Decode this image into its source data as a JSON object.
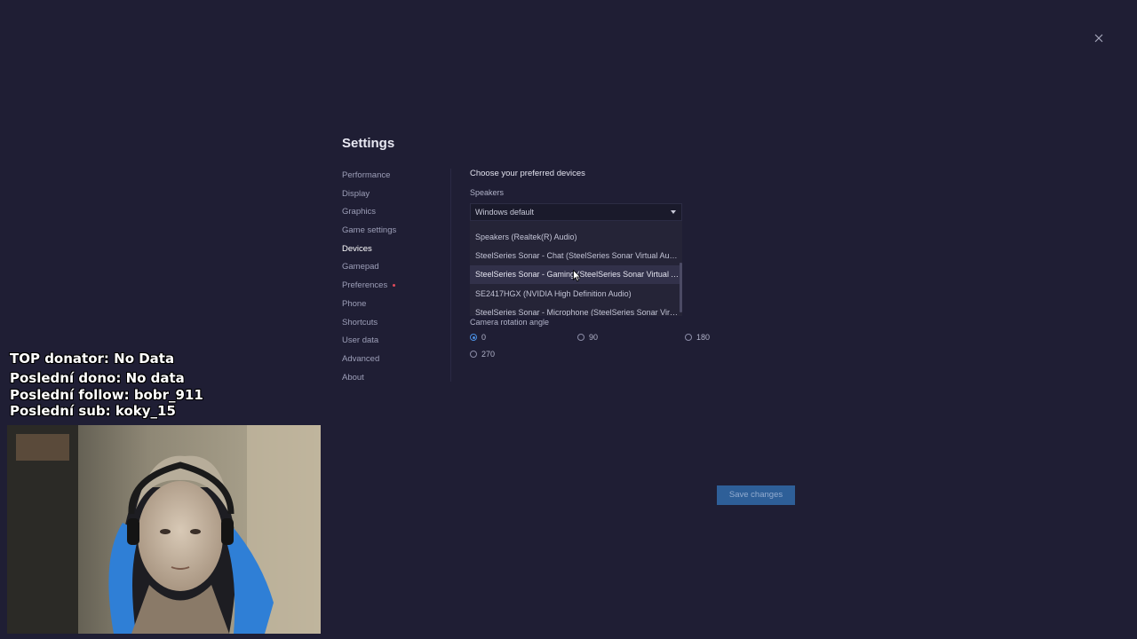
{
  "settings": {
    "title": "Settings",
    "nav": [
      {
        "label": "Performance",
        "name": "nav-performance",
        "active": false,
        "badge": false
      },
      {
        "label": "Display",
        "name": "nav-display",
        "active": false,
        "badge": false
      },
      {
        "label": "Graphics",
        "name": "nav-graphics",
        "active": false,
        "badge": false
      },
      {
        "label": "Game settings",
        "name": "nav-game-settings",
        "active": false,
        "badge": false
      },
      {
        "label": "Devices",
        "name": "nav-devices",
        "active": true,
        "badge": false
      },
      {
        "label": "Gamepad",
        "name": "nav-gamepad",
        "active": false,
        "badge": false
      },
      {
        "label": "Preferences",
        "name": "nav-preferences",
        "active": false,
        "badge": true
      },
      {
        "label": "Phone",
        "name": "nav-phone",
        "active": false,
        "badge": false
      },
      {
        "label": "Shortcuts",
        "name": "nav-shortcuts",
        "active": false,
        "badge": false
      },
      {
        "label": "User data",
        "name": "nav-user-data",
        "active": false,
        "badge": false
      },
      {
        "label": "Advanced",
        "name": "nav-advanced",
        "active": false,
        "badge": false
      },
      {
        "label": "About",
        "name": "nav-about",
        "active": false,
        "badge": false
      }
    ],
    "devices": {
      "heading": "Choose your preferred devices",
      "speakers_label": "Speakers",
      "speakers_selected": "Windows default",
      "speaker_options": [
        "Speakers (Realtek(R) Audio)",
        "SteelSeries Sonar - Chat (SteelSeries Sonar Virtual Audio Device)",
        "SteelSeries Sonar - Gaming (SteelSeries Sonar Virtual Audio Device)",
        "SE2417HGX (NVIDIA High Definition Audio)",
        "SteelSeries Sonar - Microphone (SteelSeries Sonar Virtual Audio Device)"
      ],
      "hovered_option_index": 2,
      "camera_rotation_label": "Camera rotation angle",
      "camera_rotation_options": [
        "0",
        "90",
        "180",
        "270"
      ],
      "camera_rotation_selected": "0"
    },
    "save_label": "Save changes"
  },
  "stream_overlay": {
    "top_donator": "TOP donator: No Data",
    "last_dono": "Poslední dono: No data",
    "last_follow": "Poslední follow: bobr_911",
    "last_sub": "Poslední sub: koky_15"
  },
  "colors": {
    "background": "#1f1e34",
    "accent": "#4a8ee0",
    "save_button": "#2e5f98",
    "badge": "#e04a5a"
  }
}
